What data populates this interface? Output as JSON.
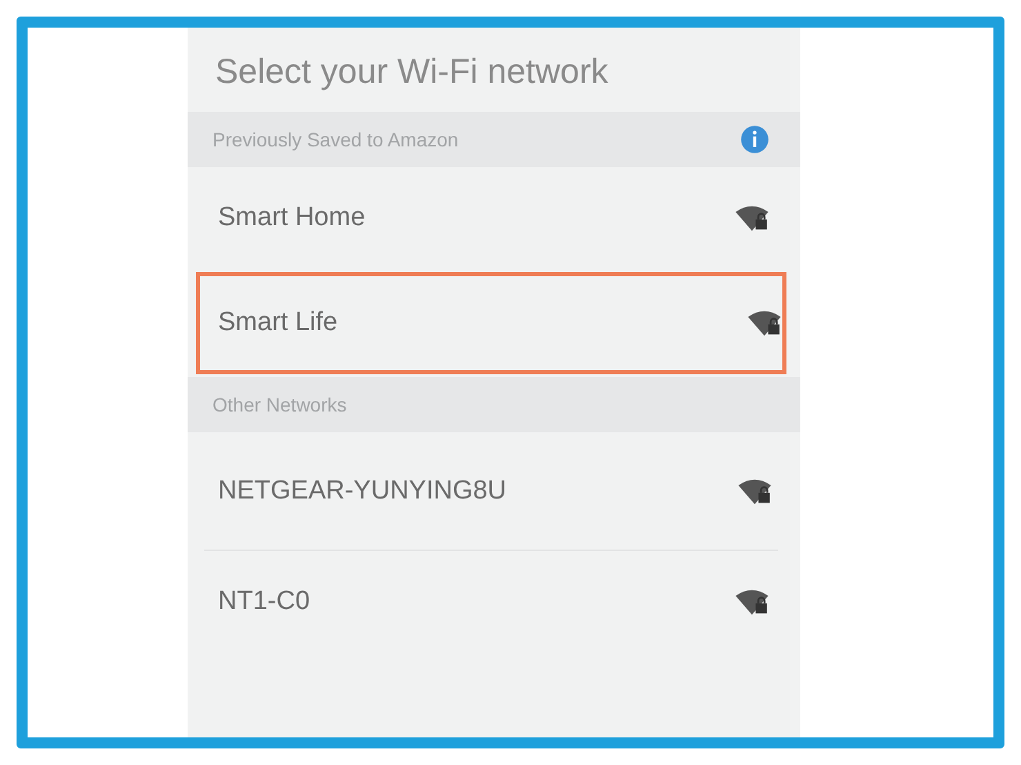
{
  "title": "Select your Wi-Fi network",
  "sections": [
    {
      "header": "Previously Saved to Amazon",
      "info": true,
      "networks": [
        {
          "name": "Smart Home",
          "highlighted": false,
          "divider": false
        },
        {
          "name": "Smart Life",
          "highlighted": true,
          "divider": false
        }
      ]
    },
    {
      "header": "Other Networks",
      "info": false,
      "networks": [
        {
          "name": "NETGEAR-YUNYING8U",
          "highlighted": false,
          "divider": true
        },
        {
          "name": "NT1-C0",
          "highlighted": false,
          "divider": false
        }
      ]
    }
  ]
}
